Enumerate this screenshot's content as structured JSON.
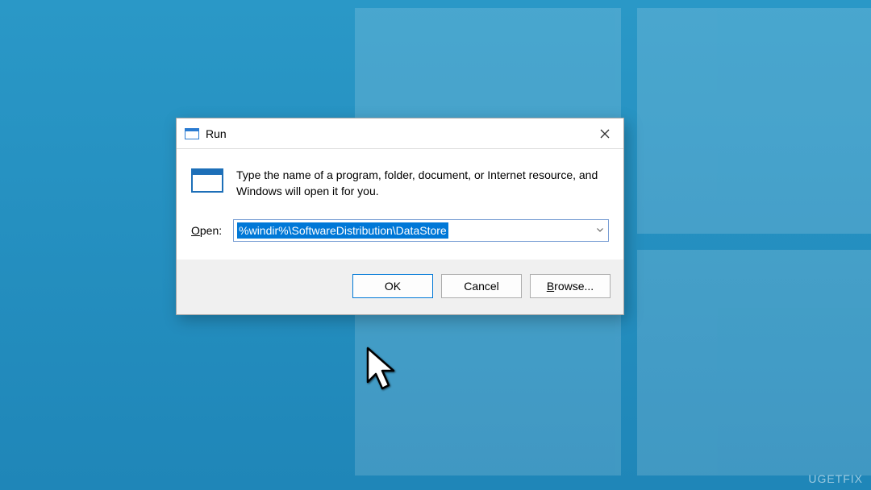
{
  "dialog": {
    "title": "Run",
    "description": "Type the name of a program, folder, document, or Internet resource, and Windows will open it for you.",
    "open_label_prefix": "O",
    "open_label_rest": "pen:",
    "input_value": "%windir%\\SoftwareDistribution\\DataStore",
    "buttons": {
      "ok": "OK",
      "cancel": "Cancel",
      "browse_prefix": "B",
      "browse_rest": "rowse..."
    }
  },
  "watermark": "UGETFIX"
}
